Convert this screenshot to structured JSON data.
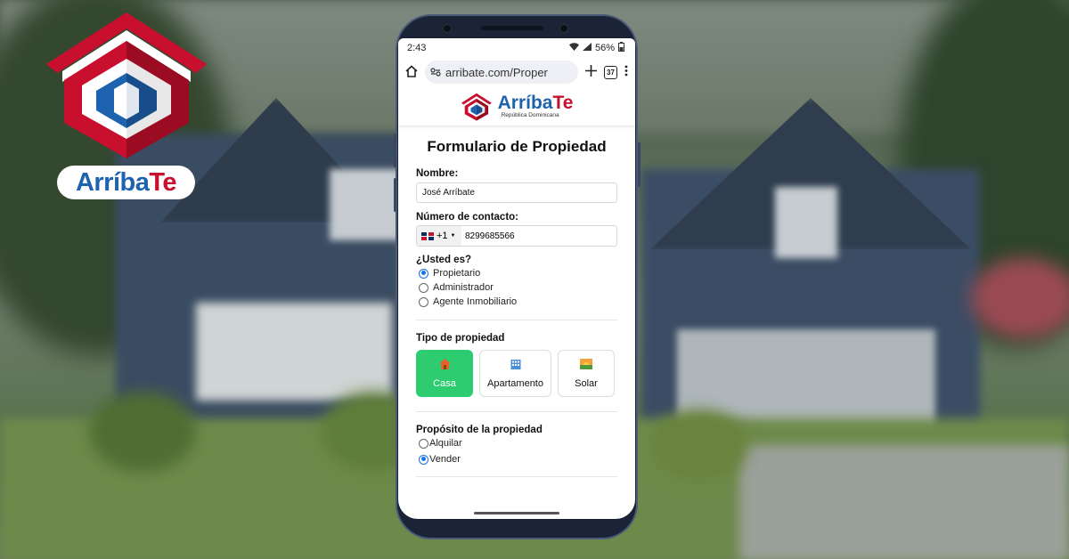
{
  "brand": {
    "name_part1": "Arríba",
    "name_part2": "Te",
    "subtitle": "República Dominicana",
    "colors": {
      "blue": "#1e63b0",
      "red": "#c8102e"
    }
  },
  "status_bar": {
    "time": "2:43",
    "battery": "56%"
  },
  "browser": {
    "url": "arribate.com/Proper",
    "tab_count": "37"
  },
  "form": {
    "title": "Formulario de Propiedad",
    "name_label": "Nombre:",
    "name_value": "José Arríbate",
    "contact_label": "Número de contacto:",
    "country_code": "+1",
    "phone_value": "8299685566",
    "role_label": "¿Usted es?",
    "roles": [
      {
        "label": "Propietario",
        "selected": true
      },
      {
        "label": "Administrador",
        "selected": false
      },
      {
        "label": "Agente Inmobiliario",
        "selected": false
      }
    ],
    "property_type_label": "Tipo de propiedad",
    "property_types": [
      {
        "label": "Casa",
        "icon": "house-icon",
        "selected": true
      },
      {
        "label": "Apartamento",
        "icon": "building-icon",
        "selected": false
      },
      {
        "label": "Solar",
        "icon": "sunset-icon",
        "selected": false
      }
    ],
    "purpose_label": "Propósito de la propiedad",
    "purposes": [
      {
        "label": "Alquilar",
        "selected": false
      },
      {
        "label": "Vender",
        "selected": true
      }
    ],
    "active_color": "#2ecc71"
  }
}
